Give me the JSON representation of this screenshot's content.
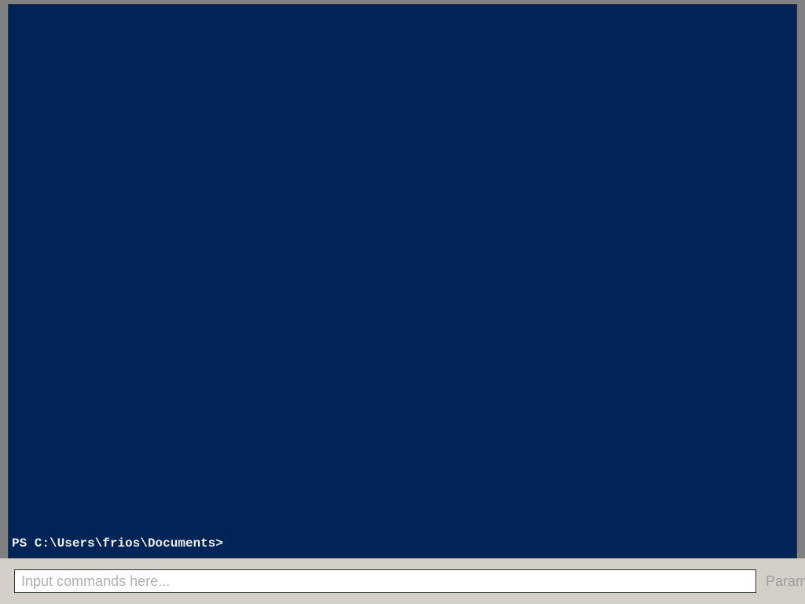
{
  "terminal": {
    "prompt": "PS C:\\Users\\frios\\Documents>"
  },
  "bottom_bar": {
    "command_input": {
      "placeholder": "Input commands here...",
      "value": ""
    },
    "param_label": "Param"
  }
}
